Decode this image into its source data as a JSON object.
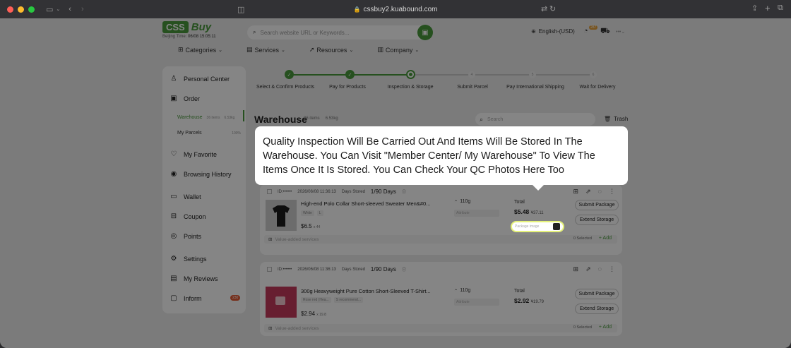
{
  "browser": {
    "url": "cssbuy2.kuabound.com"
  },
  "header": {
    "logo_box": "CSS",
    "logo_word": "Buy",
    "beijing_label": "Beijing Time:",
    "beijing_time": "06/08 15:05:11",
    "search_placeholder": "Search website URL or Keywords...",
    "language": "English-(USD)",
    "message_badge": "287"
  },
  "nav": [
    {
      "label": "Categories"
    },
    {
      "label": "Services"
    },
    {
      "label": "Resources"
    },
    {
      "label": "Company"
    }
  ],
  "sidebar": {
    "personal_center": "Personal Center",
    "order": "Order",
    "warehouse": "Warehouse",
    "warehouse_meta_items": "36 items",
    "warehouse_meta_weight": "6.53kg",
    "my_parcels": "My Parcels",
    "my_parcels_meta": "100%",
    "my_favorite": "My Favorite",
    "browsing_history": "Browsing History",
    "wallet": "Wallet",
    "coupon": "Coupon",
    "points": "Points",
    "settings": "Settings",
    "my_reviews": "My Reviews",
    "inform": "Inform",
    "inform_badge": "230"
  },
  "steps": [
    {
      "num": "1",
      "label": "Select & Confirm Products"
    },
    {
      "num": "2",
      "label": "Pay for Products"
    },
    {
      "num": "3",
      "label": "Inspection & Storage"
    },
    {
      "num": "4",
      "label": "Submit Parcel"
    },
    {
      "num": "5",
      "label": "Pay International Shipping"
    },
    {
      "num": "6",
      "label": "Wait for Delivery"
    }
  ],
  "warehouse": {
    "title": "Warehouse",
    "items": "36 items",
    "weight": "6.53kg",
    "search_placeholder": "Search",
    "trash": "Trash"
  },
  "tooltip": {
    "text": "Quality Inspection Will Be Carried Out And Items Will Be Stored In The Warehouse. You Can Visit \"Member Center/ My Warehouse\" To View The Items Once It Is Stored. You Can Check Your QC Photos Here Too"
  },
  "cards": [
    {
      "id": "ID:••••••",
      "date": "2026/06/08 11:36:13",
      "stored_label": "Days Stored",
      "days": "1/90 Days",
      "name": "High-end Polo Collar Short-sleeved Sweater Men&#0...",
      "opt1": "White",
      "opt2": "L",
      "price": "$6.5",
      "qty": "x 44",
      "weight": "110g",
      "attr": "Attribute",
      "total_label": "Total",
      "total": "$5.48",
      "total_cny": "¥37.11",
      "pkg": "Package image",
      "btn1": "Submit Package",
      "btn2": "Extend Storage",
      "vas": "Value-added services",
      "vas_count": "0 Selected",
      "add": "+ Add"
    },
    {
      "id": "ID:••••••",
      "date": "2026/06/08 11:36:13",
      "stored_label": "Days Stored",
      "days": "1/90 Days",
      "name": "300g Heavyweight Pure Cotton Short-Sleeved T-Shirt...",
      "opt1": "Rose red (Hea...",
      "opt2": "S recommend...",
      "price": "$2.94",
      "qty": "x 19.8",
      "weight": "110g",
      "attr": "Attribute",
      "total_label": "Total",
      "total": "$2.92",
      "total_cny": "¥19.79",
      "btn1": "Submit Package",
      "btn2": "Extend Storage",
      "vas": "Value-added services",
      "vas_count": "0 Selected",
      "add": "+ Add"
    }
  ],
  "colors": {
    "accent": "#4a9a3d",
    "badge": "#e35b35"
  }
}
